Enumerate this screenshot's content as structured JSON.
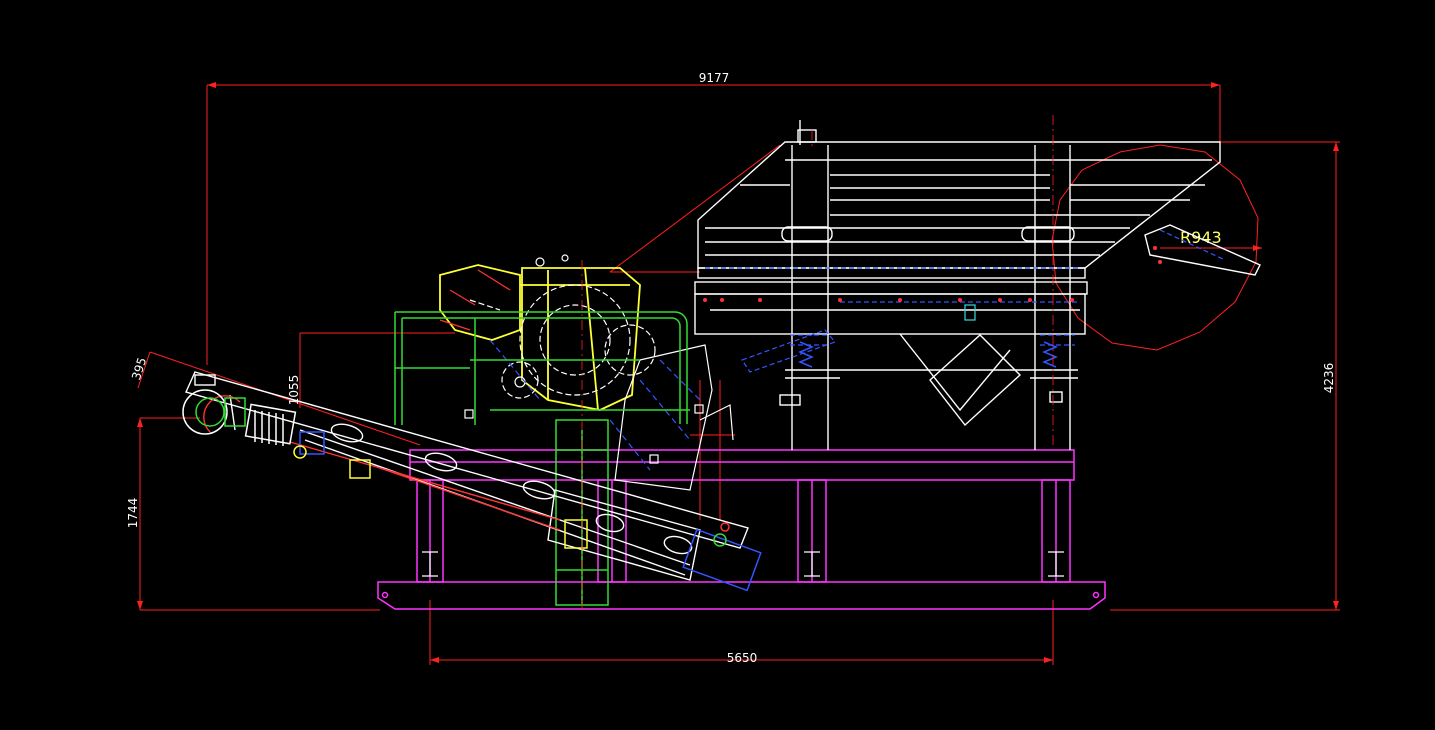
{
  "drawing": {
    "background": "#000000",
    "colors": {
      "dimension": "#ff2020",
      "frame": "#ff33ff",
      "screen": "#ffffff",
      "crusher": "#ffff33",
      "hopper": "#33dd33",
      "conveyor": "#ffffff",
      "hidden": "#3355ff",
      "annotation_text": "#ffff66"
    },
    "dimensions": {
      "overall_length": "9177",
      "base_length": "5650",
      "overall_height": "4236",
      "conveyor_height": "1744",
      "hopper_height": "1055",
      "conveyor_width": "395",
      "swing_radius": "R943"
    }
  }
}
